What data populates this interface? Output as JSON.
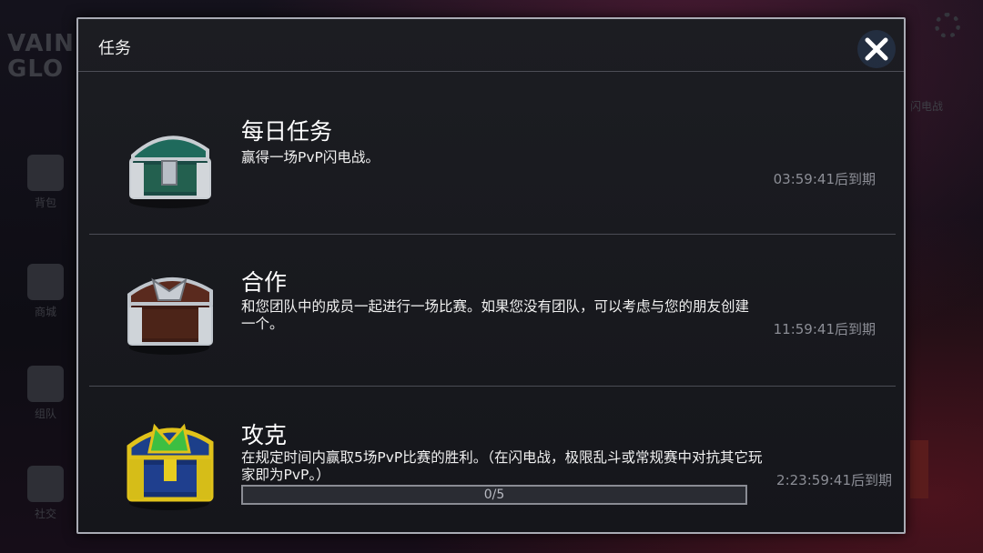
{
  "background": {
    "logo": "VAIN GLO",
    "sidebar": [
      {
        "label": "背包",
        "icon": "backpack-icon"
      },
      {
        "label": "商城",
        "icon": "cart-icon"
      },
      {
        "label": "组队",
        "icon": "team-icon"
      },
      {
        "label": "社交",
        "icon": "social-icon"
      }
    ],
    "right_text": "闪电战"
  },
  "dialog": {
    "title": "任务",
    "close_icon": "close-icon"
  },
  "missions": [
    {
      "title": "每日任务",
      "description": "赢得一场PvP闪电战。",
      "timer": "03:59:41后到期",
      "chest": "green-chest",
      "chest_color": "#1f6a5c"
    },
    {
      "title": "合作",
      "description": "和您团队中的成员一起进行一场比赛。如果您没有团队，可以考虑与您的朋友创建一个。",
      "timer": "11:59:41后到期",
      "chest": "wooden-chest",
      "chest_color": "#5a2a1e"
    },
    {
      "title": "攻克",
      "description": "在规定时间内赢取5场PvP比赛的胜利。（在闪电战，极限乱斗或常规赛中对抗其它玩家即为PvP。）",
      "timer": "2:23:59:41后到期",
      "chest": "golden-chest",
      "chest_color": "#c9a800",
      "progress": {
        "current": 0,
        "total": 5,
        "label": "0/5"
      }
    }
  ]
}
